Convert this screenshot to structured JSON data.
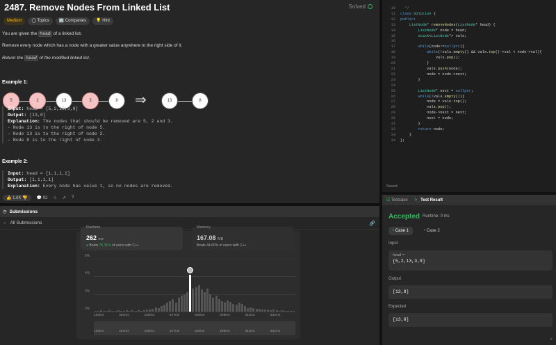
{
  "problem": {
    "title": "2487. Remove Nodes From Linked List",
    "solved": "Solved",
    "tags": [
      "Medium",
      "Topics",
      "Companies",
      "Hint"
    ],
    "desc": [
      [
        "You are given the ",
        "head",
        " of a linked list."
      ],
      [
        "Remove every node which has a node with a greater value anywhere to the right side of it."
      ],
      [
        "Return the ",
        "head",
        " of the modified linked list."
      ]
    ],
    "example1": {
      "title": "Example 1:",
      "nodes_in": [
        "5",
        "2",
        "13",
        "3",
        "8"
      ],
      "removed": [
        true,
        true,
        false,
        true,
        false
      ],
      "nodes_out": [
        "13",
        "8"
      ],
      "lines": [
        [
          "Input:",
          " head = [5,2,13,3,8]"
        ],
        [
          "Output:",
          " [13,8]"
        ],
        [
          "Explanation:",
          " The nodes that should be removed are 5, 2 and 3."
        ],
        [
          "",
          "- Node 13 is to the right of node 5."
        ],
        [
          "",
          "- Node 13 is to the right of node 2."
        ],
        [
          "",
          "- Node 8 is to the right of node 3."
        ]
      ]
    },
    "example2": {
      "title": "Example 2:",
      "lines": [
        [
          "Input:",
          " head = [1,1,1,1]"
        ],
        [
          "Output:",
          " [1,1,1,1]"
        ],
        [
          "Explanation:",
          " Every node has value 1, so no nodes are removed."
        ]
      ]
    },
    "likes": "1.8K",
    "comments": "92"
  },
  "code": {
    "lines": [
      {
        "n": "10",
        "t": "  */"
      },
      {
        "n": "11",
        "t": "class Solution {"
      },
      {
        "n": "12",
        "t": "public:"
      },
      {
        "n": "13",
        "t": "    ListNode* removeNodes(ListNode* head) {"
      },
      {
        "n": "14",
        "t": "        ListNode* node = head;"
      },
      {
        "n": "15",
        "t": "        stack<ListNode*> vals;"
      },
      {
        "n": "16",
        "t": ""
      },
      {
        "n": "17",
        "t": "        while(node!=nullptr){"
      },
      {
        "n": "18",
        "t": "            while(!vals.empty() && vals.top()->val < node->val){"
      },
      {
        "n": "19",
        "t": "                vals.pop();"
      },
      {
        "n": "20",
        "t": "            }"
      },
      {
        "n": "21",
        "t": "            vals.push(node);"
      },
      {
        "n": "22",
        "t": "            node = node->next;"
      },
      {
        "n": "23",
        "t": "        }"
      },
      {
        "n": "24",
        "t": ""
      },
      {
        "n": "25",
        "t": "        ListNode* next = nullptr;"
      },
      {
        "n": "26",
        "t": "        while(!vals.empty()){"
      },
      {
        "n": "27",
        "t": "            node = vals.top();"
      },
      {
        "n": "28",
        "t": "            vals.pop();"
      },
      {
        "n": "29",
        "t": "            node->next = next;"
      },
      {
        "n": "30",
        "t": "            next = node;"
      },
      {
        "n": "31",
        "t": "        }"
      },
      {
        "n": "32",
        "t": "        return node;"
      },
      {
        "n": "33",
        "t": "    }"
      },
      {
        "n": "34",
        "t": "};"
      }
    ],
    "status": "Saved"
  },
  "submissions": {
    "title": "Submissions",
    "back_label": "All Submissions",
    "runtime_label": "Runtime",
    "runtime_value": "262",
    "runtime_unit": "ms",
    "runtime_beats_pre": "Beats ",
    "runtime_beats": "76.31%",
    "runtime_beats_post": " of users with C++",
    "memory_label": "Memory",
    "memory_value": "167.08",
    "memory_unit": "MB",
    "memory_beats_pre": "Beats ",
    "memory_beats": "44.60%",
    "memory_beats_post": " of users with C++",
    "y_labels": [
      "6%",
      "4%",
      "2%",
      "0%"
    ],
    "x_labels": [
      "183ms",
      "204ms",
      "225ms",
      "247ms",
      "268ms",
      "289ms",
      "311ms",
      "332ms"
    ]
  },
  "chart_data": {
    "type": "bar",
    "title": "",
    "xlabel": "",
    "ylabel": "",
    "ylim": [
      0,
      6
    ],
    "x_ticks": [
      "183ms",
      "204ms",
      "225ms",
      "247ms",
      "268ms",
      "289ms",
      "311ms",
      "332ms"
    ],
    "highlight_index": 33,
    "values": [
      0.1,
      0.1,
      0.15,
      0.1,
      0.1,
      0.15,
      0.1,
      0.1,
      0.15,
      0.1,
      0.1,
      0.15,
      0.1,
      0.15,
      0.1,
      0.15,
      0.1,
      0.15,
      0.2,
      0.2,
      0.3,
      0.5,
      0.4,
      0.6,
      0.8,
      1.0,
      1.2,
      1.4,
      1.0,
      1.6,
      1.8,
      2.0,
      2.2,
      4.2,
      2.6,
      2.8,
      3.0,
      2.5,
      2.2,
      2.6,
      2.0,
      1.6,
      1.8,
      1.4,
      1.2,
      1.0,
      1.3,
      1.1,
      0.9,
      0.8,
      1.0,
      0.9,
      0.6,
      0.4,
      0.5,
      0.4,
      0.3,
      0.3,
      0.2,
      0.2,
      0.2,
      0.15,
      0.2,
      0.15,
      0.1,
      0.15,
      0.1,
      0.1,
      0.1,
      0.1
    ]
  },
  "result": {
    "tab_testcase": "Testcase",
    "tab_result": "Test Result",
    "status": "Accepted",
    "runtime": "Runtime: 0 ms",
    "case1": "Case 1",
    "case2": "Case 2",
    "input_label": "Input",
    "input_key": "head =",
    "input_value": "[5,2,13,3,8]",
    "output_label": "Output",
    "output_value": "[13,8]",
    "expected_label": "Expected",
    "expected_value": "[13,8]"
  }
}
